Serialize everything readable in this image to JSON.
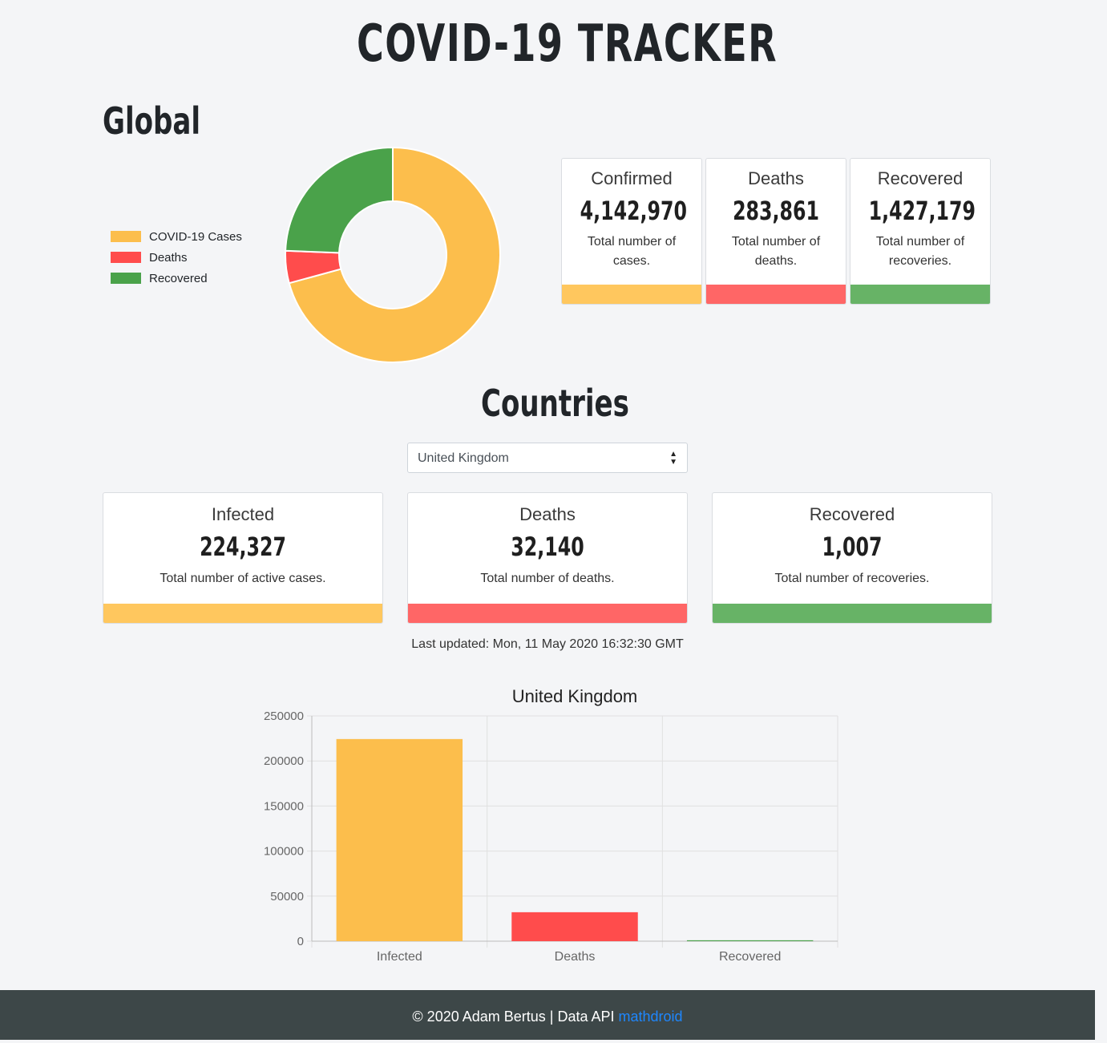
{
  "header": {
    "title": "COVID-19 TRACKER"
  },
  "global": {
    "heading": "Global",
    "legend": [
      {
        "label": "COVID-19 Cases",
        "color": "#fcbe4c"
      },
      {
        "label": "Deaths",
        "color": "#ff4c4c"
      },
      {
        "label": "Recovered",
        "color": "#4aa24a"
      }
    ],
    "donut": {
      "slices": [
        {
          "label": "COVID-19 Cases",
          "value": 4142970,
          "color": "#fcbe4c"
        },
        {
          "label": "Deaths",
          "value": 283861,
          "color": "#ff4c4c"
        },
        {
          "label": "Recovered",
          "value": 1427179,
          "color": "#4aa24a"
        }
      ]
    },
    "cards": [
      {
        "title": "Confirmed",
        "value": "4,142,970",
        "desc": "Total number of cases.",
        "color": "#ffc75e"
      },
      {
        "title": "Deaths",
        "value": "283,861",
        "desc": "Total number of deaths.",
        "color": "#ff6666"
      },
      {
        "title": "Recovered",
        "value": "1,427,179",
        "desc": "Total number of recoveries.",
        "color": "#67b366"
      }
    ]
  },
  "countries": {
    "heading": "Countries",
    "selected": "United Kingdom",
    "cards": [
      {
        "title": "Infected",
        "value": "224,327",
        "desc": "Total number of active cases.",
        "color": "#ffc75e"
      },
      {
        "title": "Deaths",
        "value": "32,140",
        "desc": "Total number of deaths.",
        "color": "#ff6666"
      },
      {
        "title": "Recovered",
        "value": "1,007",
        "desc": "Total number of recoveries.",
        "color": "#67b366"
      }
    ],
    "last_updated": "Last updated: Mon, 11 May 2020 16:32:30 GMT"
  },
  "chart_data": [
    {
      "type": "pie",
      "categories": [
        "COVID-19 Cases",
        "Deaths",
        "Recovered"
      ],
      "values": [
        4142970,
        283861,
        1427179
      ],
      "colors": [
        "#fcbe4c",
        "#ff4c4c",
        "#4aa24a"
      ],
      "legend": "left"
    },
    {
      "type": "bar",
      "title": "United Kingdom",
      "categories": [
        "Infected",
        "Deaths",
        "Recovered"
      ],
      "values": [
        224327,
        32140,
        1007
      ],
      "colors": [
        "#fcbe4c",
        "#ff4c4c",
        "#4aa24a"
      ],
      "yticks": [
        "0",
        "50000",
        "100000",
        "150000",
        "200000",
        "250000"
      ],
      "ylim": [
        0,
        250000
      ],
      "grid": true
    }
  ],
  "footer": {
    "text": "© 2020 Adam Bertus | Data API ",
    "link": "mathdroid"
  }
}
